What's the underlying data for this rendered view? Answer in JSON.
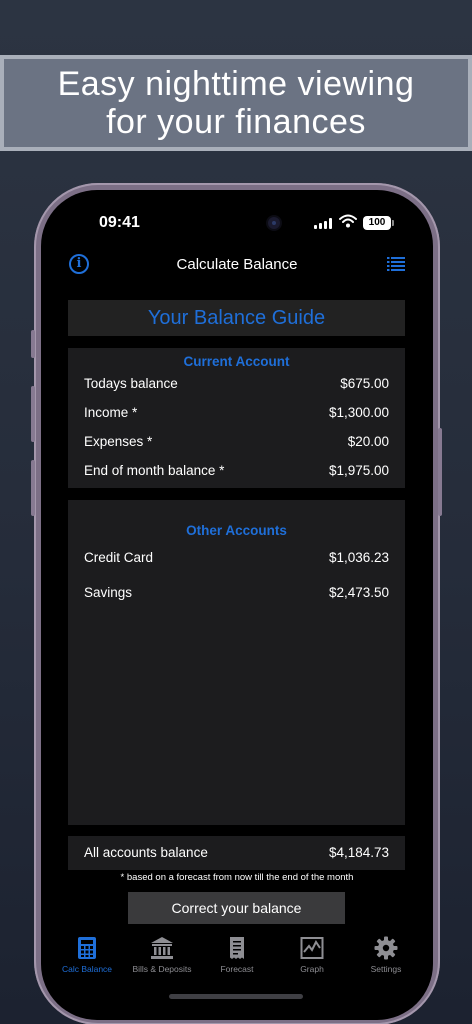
{
  "banner": {
    "line1": "Easy nighttime viewing",
    "line2": "for your finances"
  },
  "status": {
    "time": "09:41",
    "battery": "100"
  },
  "nav": {
    "title": "Calculate Balance",
    "left_icon": "info-icon",
    "right_icon": "list-icon"
  },
  "guide_title": "Your Balance Guide",
  "current_account": {
    "heading": "Current Account",
    "rows": [
      {
        "label": "Todays balance",
        "value": "$675.00"
      },
      {
        "label": "Income *",
        "value": "$1,300.00"
      },
      {
        "label": "Expenses *",
        "value": "$20.00"
      },
      {
        "label": "End of month balance *",
        "value": "$1,975.00"
      }
    ]
  },
  "other_accounts": {
    "heading": "Other Accounts",
    "rows": [
      {
        "label": "Credit Card",
        "value": "$1,036.23"
      },
      {
        "label": "Savings",
        "value": "$2,473.50"
      }
    ]
  },
  "total": {
    "label": "All accounts balance",
    "value": "$4,184.73"
  },
  "footnote": "* based on a forecast from now till the end of the month",
  "correct_button": "Correct your balance",
  "tabs": [
    {
      "label": "Calc Balance",
      "icon": "calculator-icon",
      "active": true
    },
    {
      "label": "Bills & Deposits",
      "icon": "bank-icon",
      "active": false
    },
    {
      "label": "Forecast",
      "icon": "receipt-icon",
      "active": false
    },
    {
      "label": "Graph",
      "icon": "graph-icon",
      "active": false
    },
    {
      "label": "Settings",
      "icon": "gear-icon",
      "active": false
    }
  ],
  "colors": {
    "accent": "#1f6fd9",
    "screen_bg": "#000000",
    "card_bg": "#1c1c1e",
    "inactive_tab": "#8e8e93"
  }
}
